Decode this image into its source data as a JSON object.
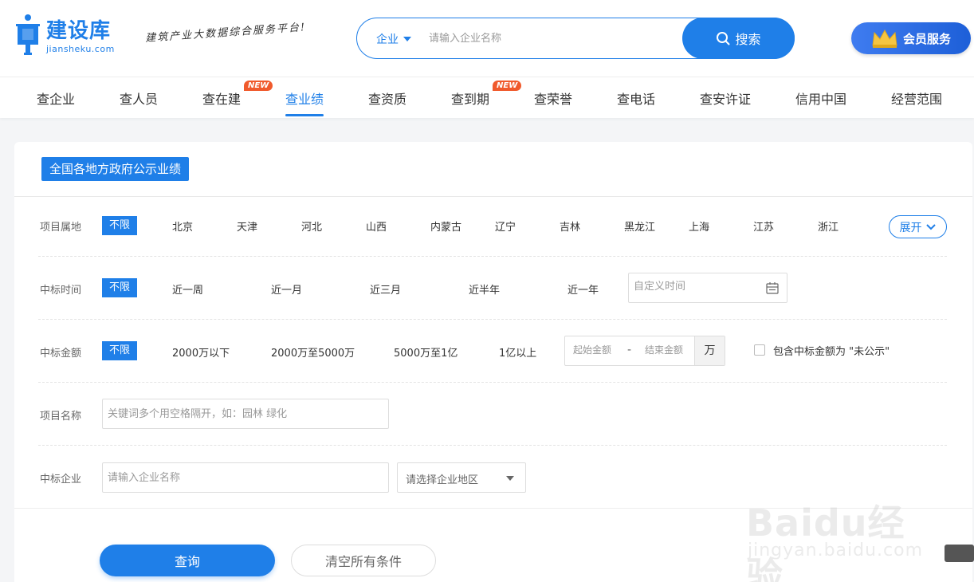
{
  "header": {
    "logo_cn": "建设库",
    "logo_en": "jiansheku.com",
    "slogan": "建筑产业大数据综合服务平台!",
    "search_type": "企业",
    "search_placeholder": "请输入企业名称",
    "search_button": "搜索",
    "vip_button": "会员服务"
  },
  "nav": {
    "items": [
      {
        "label": "查企业"
      },
      {
        "label": "查人员"
      },
      {
        "label": "查在建",
        "badge": "NEW"
      },
      {
        "label": "查业绩",
        "active": true
      },
      {
        "label": "查资质"
      },
      {
        "label": "查到期",
        "badge": "NEW"
      },
      {
        "label": "查荣誉"
      },
      {
        "label": "查电话"
      },
      {
        "label": "查安许证"
      },
      {
        "label": "信用中国"
      },
      {
        "label": "经营范围"
      }
    ]
  },
  "panel": {
    "tag": "全国各地方政府公示业绩",
    "region": {
      "label": "项目属地",
      "active": "不限",
      "options": [
        "北京",
        "天津",
        "河北",
        "山西",
        "内蒙古",
        "辽宁",
        "吉林",
        "黑龙江",
        "上海",
        "江苏",
        "浙江"
      ],
      "expand": "展开"
    },
    "time": {
      "label": "中标时间",
      "active": "不限",
      "options": [
        "近一周",
        "近一月",
        "近三月",
        "近半年",
        "近一年"
      ],
      "custom_placeholder": "自定义时间"
    },
    "amount": {
      "label": "中标金额",
      "active": "不限",
      "options": [
        "2000万以下",
        "2000万至5000万",
        "5000万至1亿",
        "1亿以上"
      ],
      "start_placeholder": "起始金额",
      "separator": "-",
      "end_placeholder": "结束金额",
      "unit": "万",
      "checkbox_label": "包含中标金额为 \"未公示\""
    },
    "project_name": {
      "label": "项目名称",
      "placeholder": "关键词多个用空格隔开，如：园林 绿化"
    },
    "winner": {
      "label": "中标企业",
      "placeholder": "请输入企业名称",
      "region_placeholder": "请选择企业地区"
    },
    "query_button": "查询",
    "clear_button": "清空所有条件"
  },
  "watermark": {
    "main": "Baidu经验",
    "sub": "jingyan.baidu.com"
  },
  "colors": {
    "accent": "#1f7fe8",
    "badge": "#f05a2c"
  }
}
